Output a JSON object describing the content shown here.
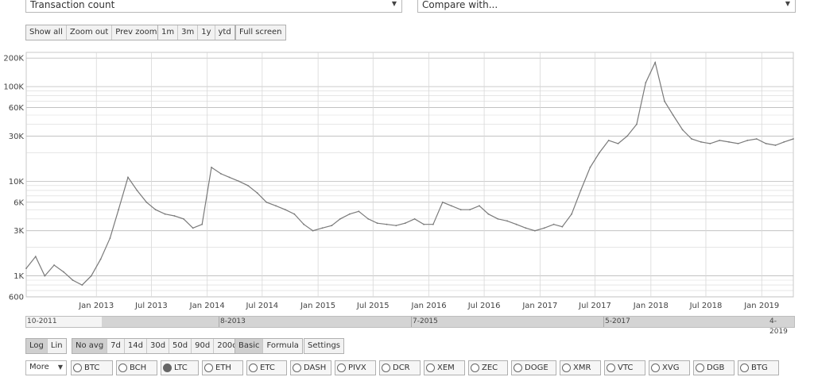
{
  "metric_select": {
    "value": "Transaction count"
  },
  "compare_select": {
    "value": "Compare with..."
  },
  "zoom_buttons": [
    "Show all",
    "Zoom out",
    "Prev zoom"
  ],
  "range_buttons": [
    "1m",
    "3m",
    "1y",
    "ytd"
  ],
  "fullscreen_label": "Full screen",
  "scale_buttons": [
    "Log",
    "Lin"
  ],
  "avg_buttons": [
    "No avg",
    "7d",
    "14d",
    "30d",
    "50d",
    "90d",
    "200d"
  ],
  "mode_buttons": [
    "Basic",
    "Formula"
  ],
  "settings_label": "Settings",
  "more_select": "More",
  "coins": [
    "BTC",
    "BCH",
    "LTC",
    "ETH",
    "ETC",
    "DASH",
    "PIVX",
    "DCR",
    "XEM",
    "ZEC",
    "DOGE",
    "XMR",
    "VTC",
    "XVG",
    "DGB",
    "BTG"
  ],
  "selected_coin": "LTC",
  "navigator_labels": [
    "10-2011",
    "8-2013",
    "7-2015",
    "5-2017",
    "4-2019"
  ],
  "colors": {
    "line": "#7a7a7a",
    "grid": "#d8d8d8",
    "active_button": "#cfcfcf",
    "navigator": "#d4d4d4"
  },
  "chart_data": {
    "type": "line",
    "title": "",
    "xlabel": "",
    "ylabel": "",
    "yscale": "log",
    "ylim": [
      600,
      230000
    ],
    "xlim": [
      "2012-05-15",
      "2019-04-15"
    ],
    "grid": true,
    "y_ticks": [
      "600",
      "1K",
      "3K",
      "6K",
      "10K",
      "30K",
      "60K",
      "100K",
      "200K"
    ],
    "x_ticks": [
      "Jan 2013",
      "Jul 2013",
      "Jan 2014",
      "Jul 2014",
      "Jan 2015",
      "Jul 2015",
      "Jan 2016",
      "Jul 2016",
      "Jan 2017",
      "Jul 2017",
      "Jan 2018",
      "Jul 2018",
      "Jan 2019"
    ],
    "series": [
      {
        "x": [
          "2012-05-15",
          "2012-06-15",
          "2012-07-15",
          "2012-08-15",
          "2012-09-15",
          "2012-10-15",
          "2012-11-15",
          "2012-12-15",
          "2013-01-15",
          "2013-02-15",
          "2013-03-15",
          "2013-04-15",
          "2013-05-15",
          "2013-06-15",
          "2013-07-15",
          "2013-08-15",
          "2013-09-15",
          "2013-10-15",
          "2013-11-15",
          "2013-12-15",
          "2014-01-15",
          "2014-02-15",
          "2014-03-15",
          "2014-04-15",
          "2014-05-15",
          "2014-06-15",
          "2014-07-15",
          "2014-08-15",
          "2014-09-15",
          "2014-10-15",
          "2014-11-15",
          "2014-12-15",
          "2015-01-15",
          "2015-02-15",
          "2015-03-15",
          "2015-04-15",
          "2015-05-15",
          "2015-06-15",
          "2015-07-15",
          "2015-08-15",
          "2015-09-15",
          "2015-10-15",
          "2015-11-15",
          "2015-12-15",
          "2016-01-15",
          "2016-02-15",
          "2016-03-15",
          "2016-04-15",
          "2016-05-15",
          "2016-06-15",
          "2016-07-15",
          "2016-08-15",
          "2016-09-15",
          "2016-10-15",
          "2016-11-15",
          "2016-12-15",
          "2017-01-15",
          "2017-02-15",
          "2017-03-15",
          "2017-04-15",
          "2017-05-15",
          "2017-06-15",
          "2017-07-15",
          "2017-08-15",
          "2017-09-15",
          "2017-10-15",
          "2017-11-15",
          "2017-12-15",
          "2018-01-15",
          "2018-02-15",
          "2018-03-15",
          "2018-04-15",
          "2018-05-15",
          "2018-06-15",
          "2018-07-15",
          "2018-08-15",
          "2018-09-15",
          "2018-10-15",
          "2018-11-15",
          "2018-12-15",
          "2019-01-15",
          "2019-02-15",
          "2019-03-15",
          "2019-04-15"
        ],
        "values": [
          1200,
          1600,
          1000,
          1300,
          1100,
          900,
          800,
          1000,
          1500,
          2500,
          5000,
          11000,
          8000,
          6000,
          5000,
          4500,
          4300,
          4000,
          3200,
          3500,
          14000,
          12000,
          11000,
          10000,
          9000,
          7500,
          6000,
          5500,
          5000,
          4500,
          3500,
          3000,
          3200,
          3400,
          4000,
          4500,
          4800,
          4000,
          3600,
          3500,
          3400,
          3600,
          4000,
          3500,
          3500,
          6000,
          5500,
          5000,
          5000,
          5500,
          4500,
          4000,
          3800,
          3500,
          3200,
          3000,
          3200,
          3500,
          3300,
          4500,
          8000,
          14000,
          20000,
          27000,
          25000,
          30000,
          40000,
          110000,
          180000,
          70000,
          50000,
          35000,
          28000,
          26000,
          25000,
          27000,
          26000,
          25000,
          27000,
          28000,
          25000,
          24000,
          26000,
          28000
        ]
      }
    ]
  }
}
